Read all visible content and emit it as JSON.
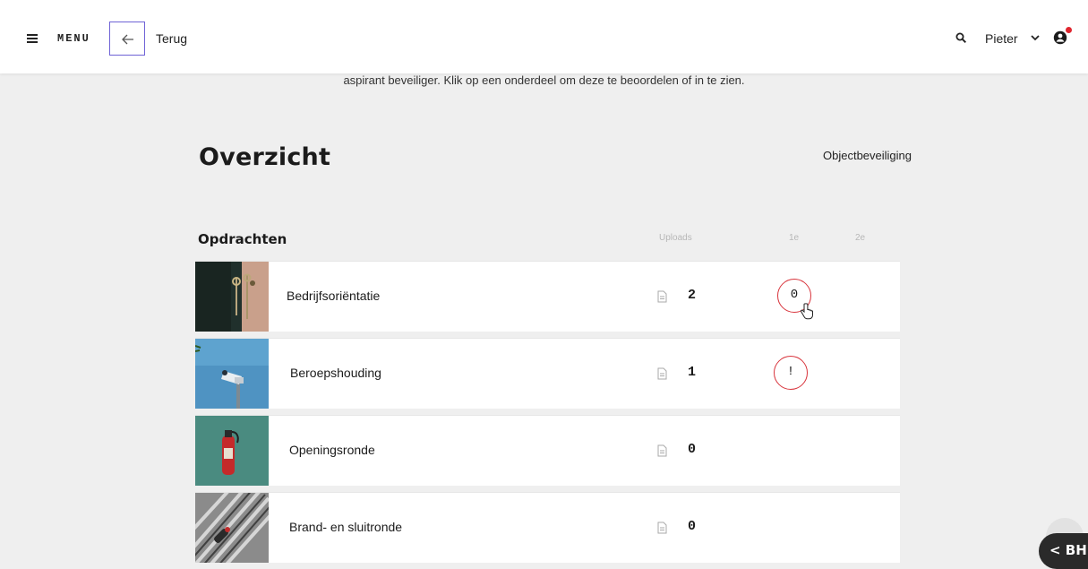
{
  "topbar": {
    "menu_label": "MENU",
    "back_label": "Terug",
    "user_name": "Pieter",
    "icons": [
      "menu-icon",
      "arrow-left-icon",
      "search-icon",
      "chevron-down-icon",
      "user-icon"
    ],
    "accent": "#6f63d6",
    "notification_color": "#e0262f"
  },
  "intro_text": "aspirant beveiliger. Klik op een onderdeel om deze te beoordelen of in te zien.",
  "page_title": "Overzicht",
  "section_label": "Objectbeveiliging",
  "list": {
    "title": "Opdrachten",
    "columns": {
      "uploads": "Uploads",
      "first": "1e",
      "second": "2e"
    },
    "rows": [
      {
        "name": "Bedrijfsoriëntatie",
        "uploads": "2",
        "first": "0",
        "second": "",
        "thumb": "keys-on-wall"
      },
      {
        "name": "Beroepshouding",
        "uploads": "1",
        "first": "!",
        "second": "",
        "thumb": "security-camera"
      },
      {
        "name": "Openingsronde",
        "uploads": "0",
        "first": "",
        "second": "",
        "thumb": "fire-extinguisher"
      },
      {
        "name": "Brand- en sluitronde",
        "uploads": "0",
        "first": "",
        "second": "",
        "thumb": "fence-lock"
      }
    ]
  },
  "score_color": "#d8343c",
  "float_button": "< BH"
}
